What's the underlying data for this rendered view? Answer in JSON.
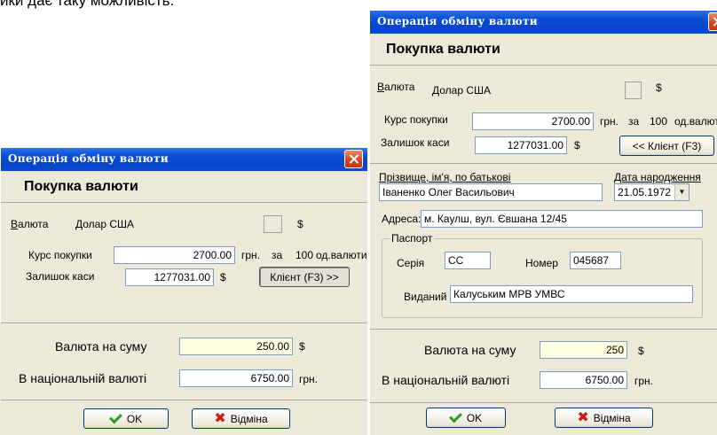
{
  "doc_text": "ики дає таку можливість.",
  "dialog_left": {
    "title": "Операція обміну валюти",
    "header": "Покупка валюти",
    "currency_label_u": "В",
    "currency_label_rest": "алюта",
    "currency_value": "Долар США",
    "currency_symbol": "$",
    "rate_label": "Курс покупки",
    "rate_value": "2700.00",
    "rate_unit": "грн.",
    "rate_for": "за",
    "rate_amount": "100",
    "rate_amount_unit": "од.валюти",
    "cash_label": "Залишок каси",
    "cash_value": "1277031.00",
    "cash_symbol": "$",
    "client_button": "Клієнт (F3) >>",
    "sum_label": "Валюта на суму",
    "sum_value": "250.00",
    "sum_symbol": "$",
    "national_label": "В національній валюті",
    "national_value": "6750.00",
    "national_unit": "грн.",
    "ok_button": "OK",
    "cancel_button": "Відміна"
  },
  "dialog_right": {
    "title": "Операція обміну валюти",
    "header": "Покупка валюти",
    "currency_label_u": "В",
    "currency_label_rest": "алюта",
    "currency_value": "Долар США",
    "currency_symbol": "$",
    "rate_label": "Курс покупки",
    "rate_value": "2700.00",
    "rate_unit": "грн.",
    "rate_for": "за",
    "rate_amount": "100",
    "rate_amount_unit": "од.валюти",
    "cash_label": "Залишок каси",
    "cash_value": "1277031.00",
    "cash_symbol": "$",
    "client_button": "<< Клієнт (F3)",
    "fullname_label": "Прізвище, ім'я, по батькові",
    "fullname_value": "Іваненко Олег Васильович",
    "birth_label": "Дата народження",
    "birth_value": "21.05.1972",
    "address_label": "Адреса:",
    "address_value": "м. Каулш, вул. Євшана 12/45",
    "passport_group": "Паспорт",
    "series_label": "Серія",
    "series_value": "СС",
    "number_label": "Номер",
    "number_value": "045687",
    "issued_label": "Виданий",
    "issued_value": "Калуським МРВ УМВС",
    "sum_label": "Валюта на суму",
    "sum_value": "250",
    "sum_symbol": "$",
    "national_label": "В національній валюті",
    "national_value": "6750.00",
    "national_unit": "грн.",
    "ok_button": "OK",
    "cancel_button": "Відміна"
  }
}
